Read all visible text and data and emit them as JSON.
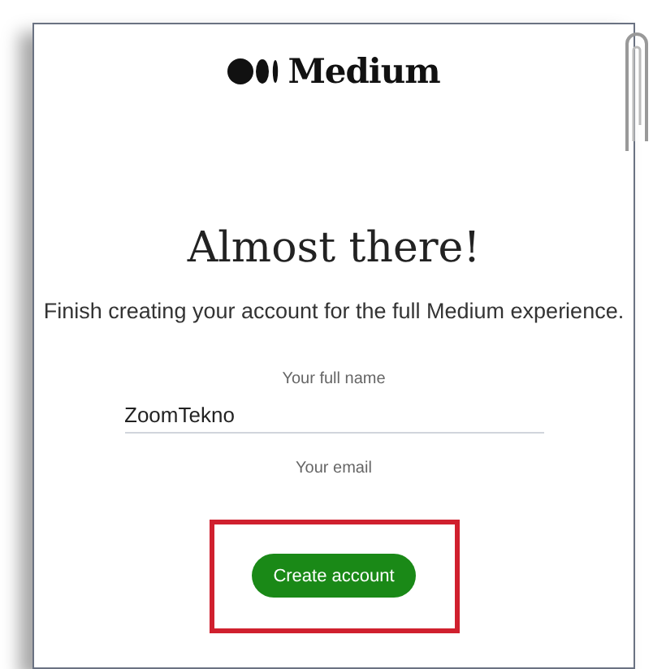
{
  "logo": {
    "text": "Medium"
  },
  "heading": "Almost there!",
  "subtitle": "Finish creating your account for the full Medium experience.",
  "fields": [
    {
      "label": "Your full name",
      "value": "ZoomTekno"
    },
    {
      "label": "Your email"
    }
  ],
  "button": {
    "label": "Create account",
    "highlighted": true
  }
}
